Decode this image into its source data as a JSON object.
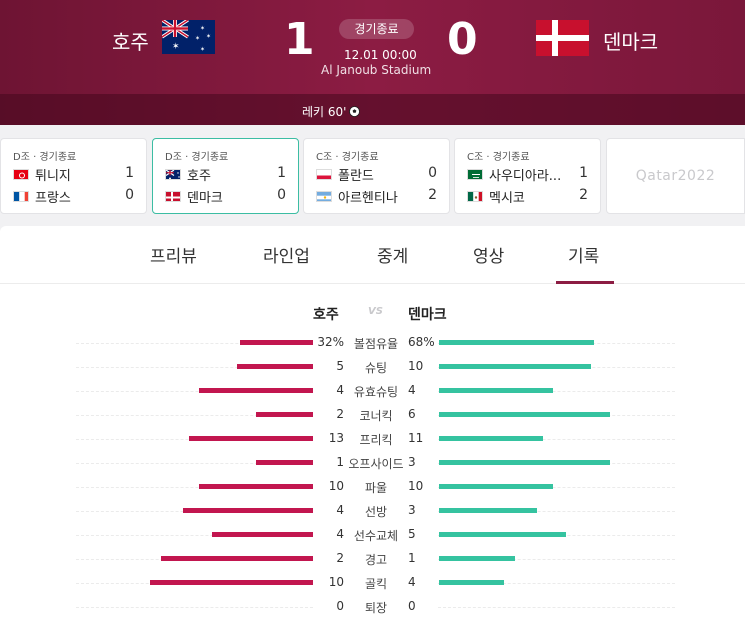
{
  "header": {
    "home_team": "호주",
    "away_team": "덴마크",
    "home_score": "1",
    "away_score": "0",
    "status": "경기종료",
    "datetime": "12.01 00:00",
    "stadium": "Al Janoub Stadium",
    "goal_event": "레키 60'",
    "colors": {
      "background": "#8c1c43",
      "home_bar": "#c2164f",
      "away_bar": "#35c3a0"
    }
  },
  "cards": [
    {
      "group": "D조 · 경기종료",
      "home": "튀니지",
      "home_flag": "tunisia-flag",
      "home_score": "1",
      "away": "프랑스",
      "away_flag": "france-flag",
      "away_score": "0",
      "active": false
    },
    {
      "group": "D조 · 경기종료",
      "home": "호주",
      "home_flag": "australia-flag",
      "home_score": "1",
      "away": "덴마크",
      "away_flag": "denmark-flag",
      "away_score": "0",
      "active": true
    },
    {
      "group": "C조 · 경기종료",
      "home": "폴란드",
      "home_flag": "poland-flag",
      "home_score": "0",
      "away": "아르헨티나",
      "away_flag": "argentina-flag",
      "away_score": "2",
      "active": false
    },
    {
      "group": "C조 · 경기종료",
      "home": "사우디아라...",
      "home_flag": "saudi-flag",
      "home_score": "1",
      "away": "멕시코",
      "away_flag": "mexico-flag",
      "away_score": "2",
      "active": false
    }
  ],
  "qatar_logo": "Qatar2022",
  "tabs": [
    "프리뷰",
    "라인업",
    "중계",
    "영상",
    "기록"
  ],
  "active_tab": "기록",
  "stats_header": {
    "home": "호주",
    "vs": "VS",
    "away": "덴마크"
  },
  "stats": [
    {
      "label": "볼점유율",
      "home": "32%",
      "away": "68%",
      "home_ratio": 0.32,
      "away_ratio": 0.68
    },
    {
      "label": "슈팅",
      "home": "5",
      "away": "10",
      "home_ratio": 0.333,
      "away_ratio": 0.667
    },
    {
      "label": "유효슈팅",
      "home": "4",
      "away": "4",
      "home_ratio": 0.5,
      "away_ratio": 0.5
    },
    {
      "label": "코너킥",
      "home": "2",
      "away": "6",
      "home_ratio": 0.25,
      "away_ratio": 0.75
    },
    {
      "label": "프리킥",
      "home": "13",
      "away": "11",
      "home_ratio": 0.542,
      "away_ratio": 0.458
    },
    {
      "label": "오프사이드",
      "home": "1",
      "away": "3",
      "home_ratio": 0.25,
      "away_ratio": 0.75
    },
    {
      "label": "파울",
      "home": "10",
      "away": "10",
      "home_ratio": 0.5,
      "away_ratio": 0.5
    },
    {
      "label": "선방",
      "home": "4",
      "away": "3",
      "home_ratio": 0.571,
      "away_ratio": 0.429
    },
    {
      "label": "선수교체",
      "home": "4",
      "away": "5",
      "home_ratio": 0.444,
      "away_ratio": 0.556
    },
    {
      "label": "경고",
      "home": "2",
      "away": "1",
      "home_ratio": 0.667,
      "away_ratio": 0.333
    },
    {
      "label": "골킥",
      "home": "10",
      "away": "4",
      "home_ratio": 0.714,
      "away_ratio": 0.286
    },
    {
      "label": "퇴장",
      "home": "0",
      "away": "0",
      "home_ratio": 0,
      "away_ratio": 0
    }
  ]
}
